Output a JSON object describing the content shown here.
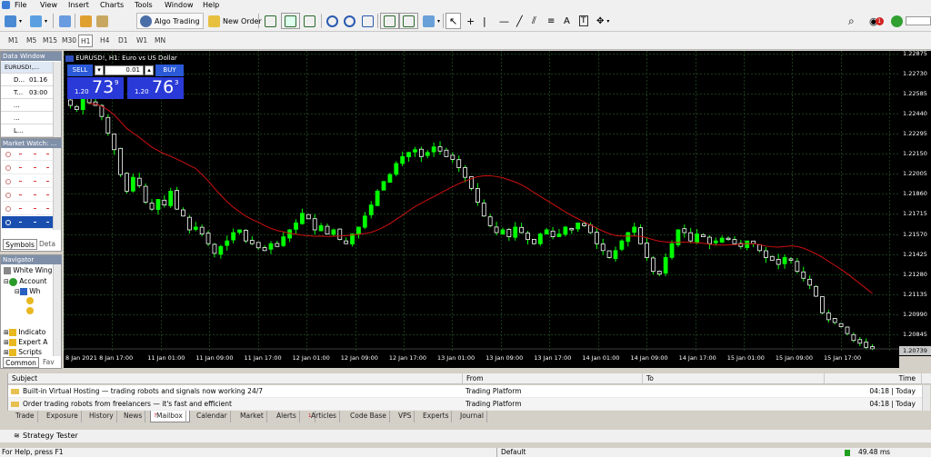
{
  "menu": [
    "File",
    "View",
    "Insert",
    "Charts",
    "Tools",
    "Window",
    "Help"
  ],
  "toolbar": {
    "algo_label": "Algo Trading",
    "new_order_label": "New Order"
  },
  "timeframes": [
    "M1",
    "M5",
    "M15",
    "M30",
    "H1",
    "H4",
    "D1",
    "W1",
    "MN"
  ],
  "active_timeframe": "H1",
  "data_window": {
    "title": "Data Window",
    "symbol": "EURUSD!,...",
    "rows": [
      {
        "k": "D...",
        "v": "01.16"
      },
      {
        "k": "T...",
        "v": "03:00"
      },
      {
        "k": "",
        "v": "..."
      },
      {
        "k": "",
        "v": "..."
      },
      {
        "k": "L...",
        "v": ""
      }
    ]
  },
  "market_watch": {
    "title": "Market Watch: ...",
    "tabs": [
      "Symbols",
      "Deta"
    ]
  },
  "navigator": {
    "title": "Navigator",
    "items": [
      "White Wing",
      "Account",
      "Wh",
      "Indicato",
      "Expert A",
      "Scripts"
    ],
    "tabs": [
      "Common",
      "Fav"
    ]
  },
  "chart": {
    "title": "EURUSD!, H1:  Euro vs US Dollar",
    "sell_label": "SELL",
    "buy_label": "BUY",
    "lot": "0.01",
    "sell_prefix": "1.20",
    "sell_big": "73",
    "sell_sup": "9",
    "buy_prefix": "1.20",
    "buy_big": "76",
    "buy_sup": "3",
    "current_price": "1.20739",
    "colors": {
      "bull": "#00ff00",
      "bear": "#ffffff",
      "ma": "#d01010",
      "grid": "#1a3a1a"
    }
  },
  "chart_data": {
    "type": "candlestick",
    "price_ticks": [
      "1.22875",
      "1.22730",
      "1.22585",
      "1.22440",
      "1.22295",
      "1.22150",
      "1.22005",
      "1.21860",
      "1.21715",
      "1.21570",
      "1.21425",
      "1.21280",
      "1.21135",
      "1.20990",
      "1.20845"
    ],
    "time_ticks": [
      "8 Jan 2021",
      "8 Jan 17:00",
      "11 Jan 01:00",
      "11 Jan 09:00",
      "11 Jan 17:00",
      "12 Jan 01:00",
      "12 Jan 09:00",
      "12 Jan 17:00",
      "13 Jan 01:00",
      "13 Jan 09:00",
      "13 Jan 17:00",
      "14 Jan 01:00",
      "14 Jan 09:00",
      "14 Jan 17:00",
      "15 Jan 01:00",
      "15 Jan 09:00",
      "15 Jan 17:00"
    ],
    "closes": [
      1.225,
      1.2247,
      1.2256,
      1.2252,
      1.225,
      1.2242,
      1.223,
      1.2218,
      1.22,
      1.2188,
      1.2198,
      1.2192,
      1.218,
      1.2175,
      1.2182,
      1.2178,
      1.2188,
      1.2175,
      1.217,
      1.216,
      1.2162,
      1.2157,
      1.215,
      1.2143,
      1.2148,
      1.2152,
      1.2158,
      1.216,
      1.2152,
      1.215,
      1.2147,
      1.2145,
      1.215,
      1.2148,
      1.2155,
      1.216,
      1.2165,
      1.2172,
      1.2168,
      1.216,
      1.2163,
      1.2157,
      1.216,
      1.2153,
      1.215,
      1.2157,
      1.2162,
      1.217,
      1.2178,
      1.2188,
      1.2195,
      1.22,
      1.2208,
      1.2213,
      1.2216,
      1.2218,
      1.2213,
      1.2216,
      1.222,
      1.2217,
      1.2213,
      1.2211,
      1.2205,
      1.2198,
      1.219,
      1.218,
      1.217,
      1.2163,
      1.2158,
      1.216,
      1.2155,
      1.2162,
      1.2158,
      1.2153,
      1.215,
      1.2157,
      1.216,
      1.2155,
      1.2157,
      1.2162,
      1.216,
      1.2165,
      1.2163,
      1.2158,
      1.215,
      1.2145,
      1.214,
      1.2145,
      1.2152,
      1.2158,
      1.2162,
      1.215,
      1.214,
      1.213,
      1.2128,
      1.214,
      1.215,
      1.216,
      1.2158,
      1.2152,
      1.2157,
      1.2155,
      1.215,
      1.2152,
      1.2154,
      1.2153,
      1.215,
      1.2148,
      1.2152,
      1.215,
      1.2145,
      1.214,
      1.2138,
      1.2135,
      1.214,
      1.2138,
      1.213,
      1.2125,
      1.212,
      1.2112,
      1.21,
      1.2095,
      1.2093,
      1.209,
      1.2085,
      1.208,
      1.2078,
      1.2075,
      1.2074
    ]
  },
  "mailbox": {
    "headers": [
      "Subject",
      "From",
      "To",
      "Time"
    ],
    "rows": [
      {
        "subject": "Built-in Virtual Hosting — trading robots and signals now working 24/7",
        "from": "Trading Platform",
        "to": "",
        "time": "04:18 | Today"
      },
      {
        "subject": "Order trading robots from freelancers — it's fast and efficient",
        "from": "Trading Platform",
        "to": "",
        "time": "04:18 | Today"
      }
    ]
  },
  "bottom_tabs": [
    "Trade",
    "Exposure",
    "History",
    "News",
    "Mailbox",
    "Calendar",
    "Market",
    "Alerts",
    "Articles",
    "Code Base",
    "VPS",
    "Experts",
    "Journal"
  ],
  "active_tab": "Mailbox",
  "mailbox_badge": "7",
  "articles_badge": "1",
  "notification_count": "1",
  "tester_label": "Strategy Tester",
  "status": {
    "help": "For Help, press F1",
    "profile": "Default",
    "speed": "49.48 ms"
  }
}
